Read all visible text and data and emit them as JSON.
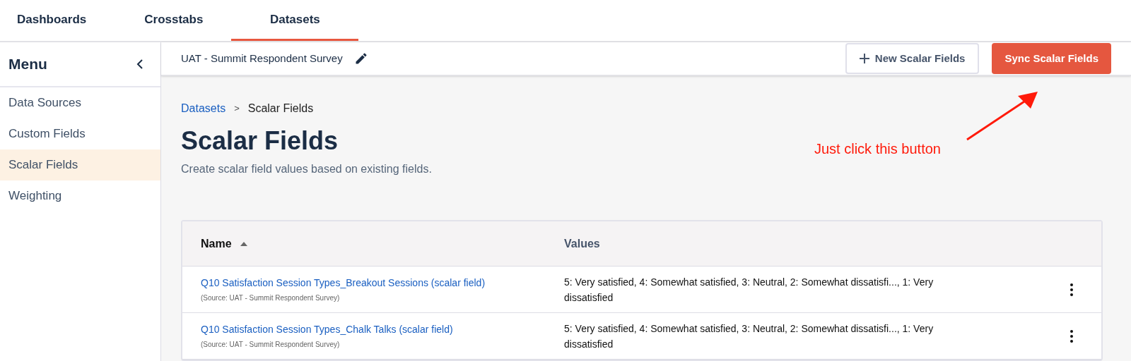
{
  "tabs": [
    {
      "label": "Dashboards",
      "selected": false
    },
    {
      "label": "Crosstabs",
      "selected": false
    },
    {
      "label": "Datasets",
      "selected": true
    }
  ],
  "sidebar": {
    "title": "Menu",
    "items": [
      {
        "label": "Data Sources",
        "selected": false
      },
      {
        "label": "Custom Fields",
        "selected": false
      },
      {
        "label": "Scalar Fields",
        "selected": true
      },
      {
        "label": "Weighting",
        "selected": false
      }
    ]
  },
  "toolbar": {
    "dataset_name": "UAT - Summit Respondent Survey",
    "buttons": [
      {
        "kind": "secondary",
        "label": "New Scalar Fields"
      },
      {
        "kind": "primary",
        "label": "Sync Scalar Fields"
      }
    ]
  },
  "breadcrumb": {
    "link": "Datasets",
    "separator": ">",
    "current": "Scalar Fields"
  },
  "page": {
    "title": "Scalar Fields",
    "description": "Create scalar field values based on existing fields."
  },
  "annotation": {
    "text": "Just click this button"
  },
  "table": {
    "columns": [
      "Name",
      "Values"
    ],
    "rows": [
      {
        "name": "Q10 Satisfaction Session Types_Breakout Sessions (scalar field)",
        "source": "(Source: UAT - Summit Respondent Survey)",
        "values": "5: Very satisfied, 4: Somewhat satisfied, 3: Neutral, 2: Somewhat dissatisfi..., 1: Very dissatisfied"
      },
      {
        "name": "Q10 Satisfaction Session Types_Chalk Talks (scalar field)",
        "source": "(Source: UAT - Summit Respondent Survey)",
        "values": "5: Very satisfied, 4: Somewhat satisfied, 3: Neutral, 2: Somewhat dissatisfi..., 1: Very dissatisfied"
      }
    ]
  }
}
